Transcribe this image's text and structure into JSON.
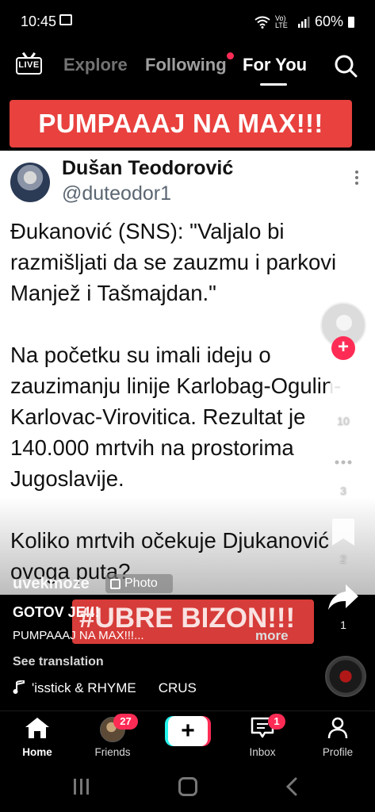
{
  "status_bar": {
    "time": "10:45",
    "network": "Vo) LTE",
    "battery": "60%"
  },
  "top_nav": {
    "live_label": "LIVE",
    "tabs": [
      "Explore",
      "Following",
      "For You"
    ],
    "active_tab": "For You",
    "icons": [
      "live-icon",
      "search-icon"
    ]
  },
  "banner": {
    "text": "PUMPAAAJ NA MAX!!!",
    "color": "#e8413e"
  },
  "tweet": {
    "author_name": "Dušan Teodorović",
    "author_handle": "@duteodor1",
    "body": "Đukanović (SNS): \"Valjalo bi razmišljati da se zauzmu i parkovi Manjež i Tašmajdan.\"\n\nNa početku su imali ideju o zauzimanju linije Karlobag-Ogulin-Karlovac-Virovitica. Rezultat je 140.000 mrtvih na prostorima Jugoslavije.\n\nKoliko mrtvih očekuje Djukanović ovoga puta?"
  },
  "actions": {
    "like_count": "10",
    "comment_count": "3",
    "save_count": "2",
    "share_count": "1"
  },
  "video_overlay": {
    "watermark": "uvekmoze",
    "photo_label": "Photo",
    "overlay_text": "#UBRE BIZON!!!"
  },
  "caption": {
    "user": "GOTOV JE!!!",
    "text": "PUMPAAAJ NA MAX!!!...",
    "more": "more",
    "see_translation": "See translation",
    "music_title": "'isstick & RHYME",
    "music_artist": "CRUS"
  },
  "bottom_nav": {
    "items": [
      "Home",
      "Friends",
      "Inbox",
      "Profile"
    ],
    "friends_badge": "27",
    "inbox_badge": "1",
    "create_symbol": "+"
  },
  "colors": {
    "accent": "#fe2c55",
    "banner": "#e8413e",
    "cyan": "#25f4ee"
  }
}
